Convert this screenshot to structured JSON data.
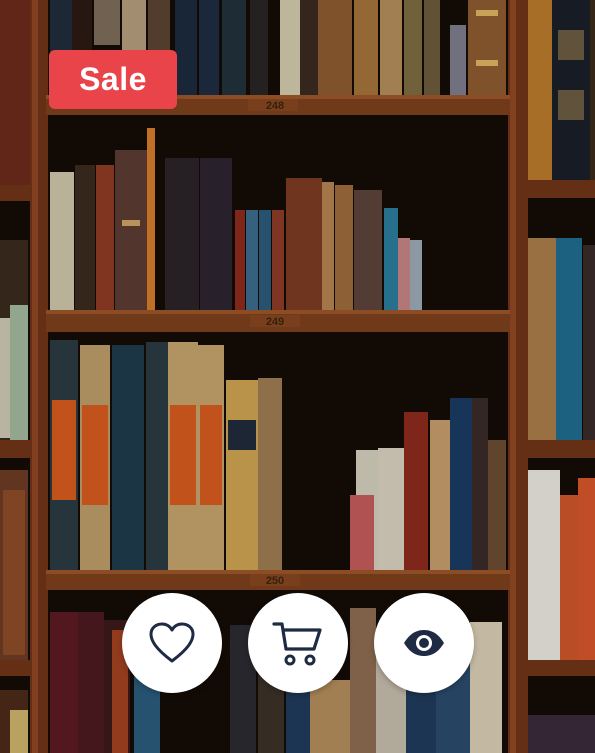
{
  "badge": {
    "label": "Sale",
    "color": "#e8444a"
  },
  "shelf_labels": [
    "248",
    "249",
    "250"
  ],
  "actions": [
    {
      "name": "wishlist-button",
      "icon": "heart-icon"
    },
    {
      "name": "add-to-cart-button",
      "icon": "cart-icon"
    },
    {
      "name": "quick-view-button",
      "icon": "eye-icon"
    }
  ],
  "colors": {
    "icon": "#1f2a44",
    "button_bg": "#ffffff",
    "wood": "#7a3e1c"
  }
}
